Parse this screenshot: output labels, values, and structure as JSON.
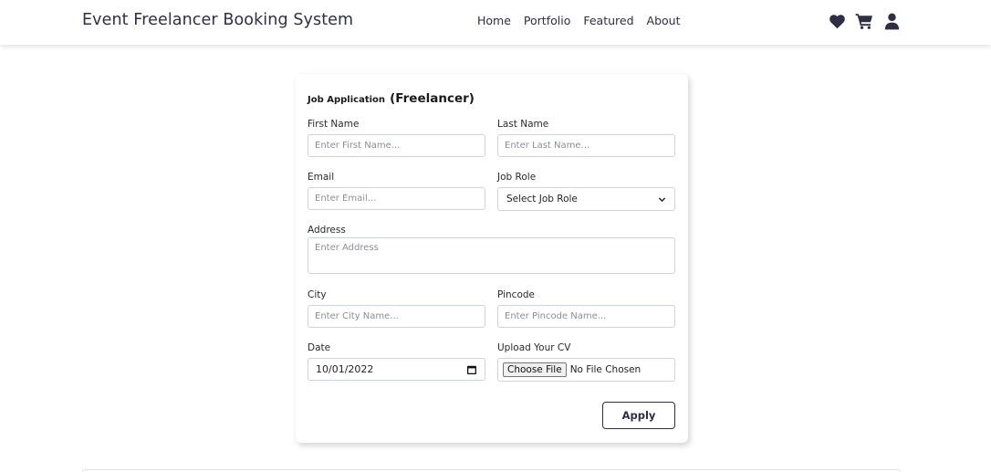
{
  "navbar": {
    "brand": "Event Freelancer Booking System",
    "links": [
      "Home",
      "Portfolio",
      "Featured",
      "About"
    ],
    "icons": [
      "heart-icon",
      "cart-icon",
      "user-icon"
    ]
  },
  "form": {
    "title_small": "Job Application",
    "title_big": "(Freelancer)",
    "first_name": {
      "label": "First Name",
      "placeholder": "Enter First Name...",
      "value": ""
    },
    "last_name": {
      "label": "Last Name",
      "placeholder": "Enter Last Name...",
      "value": ""
    },
    "email": {
      "label": "Email",
      "placeholder": "Enter Email...",
      "value": ""
    },
    "job_role": {
      "label": "Job Role",
      "selected": "Select Job Role"
    },
    "address": {
      "label": "Address",
      "placeholder": "Enter Address",
      "value": ""
    },
    "city": {
      "label": "City",
      "placeholder": "Enter City Name...",
      "value": ""
    },
    "pincode": {
      "label": "Pincode",
      "placeholder": "Enter Pincode Name...",
      "value": ""
    },
    "date": {
      "label": "Date",
      "value": "10/01/2022"
    },
    "cv": {
      "label": "Upload Your CV",
      "button": "Choose File",
      "status": "No File Chosen"
    },
    "apply_label": "Apply"
  },
  "colors": {
    "primary_text": "#2e2e45",
    "input_border": "#cfd4da",
    "placeholder": "#8a8f96"
  }
}
